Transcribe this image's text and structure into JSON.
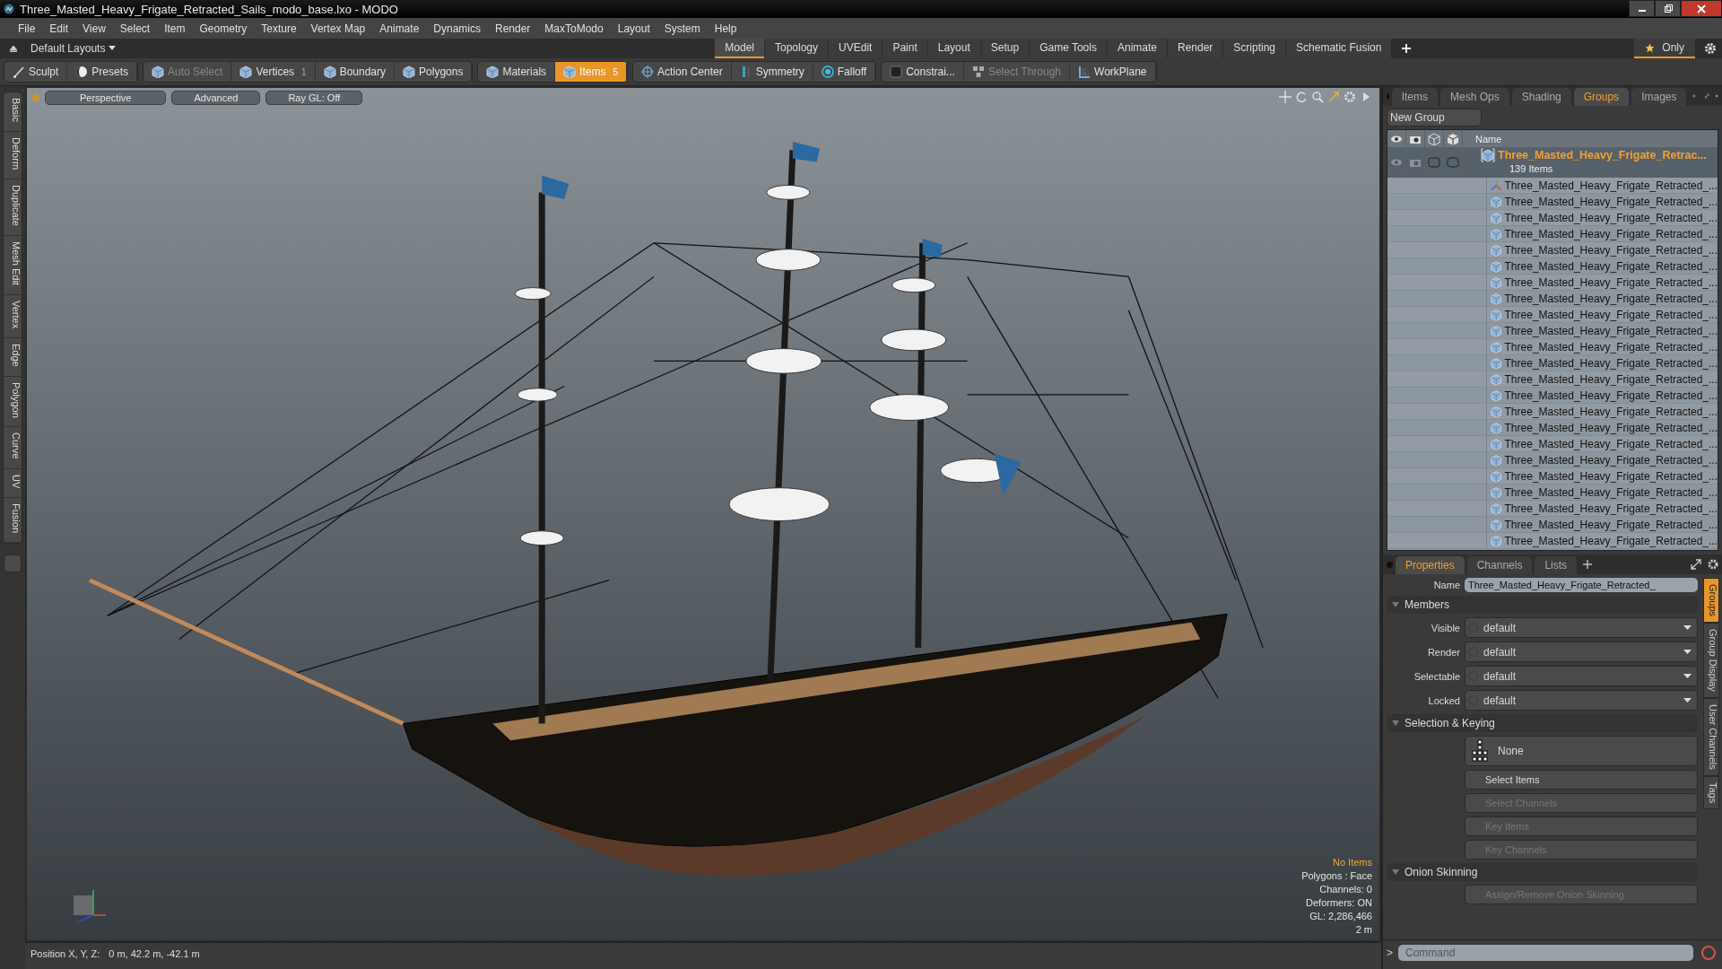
{
  "window": {
    "title": "Three_Masted_Heavy_Frigate_Retracted_Sails_modo_base.lxo - MODO"
  },
  "menu": [
    "File",
    "Edit",
    "View",
    "Select",
    "Item",
    "Geometry",
    "Texture",
    "Vertex Map",
    "Animate",
    "Dynamics",
    "Render",
    "MaxToModo",
    "Layout",
    "System",
    "Help"
  ],
  "layout_bar": {
    "layouts": "Default Layouts",
    "tabs": [
      {
        "label": "Model",
        "selected": true
      },
      {
        "label": "Topology",
        "selected": false
      },
      {
        "label": "UVEdit",
        "selected": false
      },
      {
        "label": "Paint",
        "selected": false
      },
      {
        "label": "Layout",
        "selected": false
      },
      {
        "label": "Setup",
        "selected": false
      },
      {
        "label": "Game Tools",
        "selected": false
      },
      {
        "label": "Animate",
        "selected": false
      },
      {
        "label": "Render",
        "selected": false
      },
      {
        "label": "Scripting",
        "selected": false
      },
      {
        "label": "Schematic Fusion",
        "selected": false
      }
    ],
    "only": "Only"
  },
  "toolbar": [
    [
      {
        "label": "Sculpt",
        "selected": false,
        "disabled": false
      },
      {
        "label": "Presets",
        "selected": false,
        "disabled": false
      }
    ],
    [
      {
        "label": "Auto Select",
        "selected": false,
        "disabled": true
      },
      {
        "label": "Vertices",
        "count": "1",
        "selected": false,
        "disabled": false
      },
      {
        "label": "Boundary",
        "selected": false,
        "disabled": false
      },
      {
        "label": "Polygons",
        "selected": false,
        "disabled": false
      }
    ],
    [
      {
        "label": "Materials",
        "selected": false,
        "disabled": false
      },
      {
        "label": "Items",
        "count": "5",
        "selected": true,
        "disabled": false
      }
    ],
    [
      {
        "label": "Action Center",
        "selected": false,
        "disabled": false
      },
      {
        "label": "Symmetry",
        "selected": false,
        "disabled": false
      },
      {
        "label": "Falloff",
        "selected": false,
        "disabled": false
      }
    ],
    [
      {
        "label": "Constrai...",
        "selected": false,
        "disabled": false
      },
      {
        "label": "Select Through",
        "selected": false,
        "disabled": true
      },
      {
        "label": "WorkPlane",
        "selected": false,
        "disabled": false
      }
    ]
  ],
  "left_tabs": [
    "Basic",
    "Deform",
    "Duplicate",
    "Mesh Edit",
    "Vertex",
    "Edge",
    "Polygon",
    "Curve",
    "UV",
    "Fusion"
  ],
  "viewport": {
    "buttons": [
      "Perspective",
      "Advanced",
      "Ray GL: Off"
    ],
    "info": [
      {
        "text": "No Items",
        "highlight": true
      },
      {
        "text": "Polygons : Face",
        "highlight": false
      },
      {
        "text": "Channels: 0",
        "highlight": false
      },
      {
        "text": "Deformers: ON",
        "highlight": false
      },
      {
        "text": "GL: 2,286,466",
        "highlight": false
      },
      {
        "text": "2 m",
        "highlight": false
      }
    ]
  },
  "status_bar": {
    "label": "Position X, Y, Z:",
    "value": "0 m, 42.2 m, -42.1 m"
  },
  "items_panel": {
    "tabs": [
      {
        "label": "Items",
        "selected": false
      },
      {
        "label": "Mesh Ops",
        "selected": false
      },
      {
        "label": "Shading",
        "selected": false
      },
      {
        "label": "Groups",
        "selected": true
      },
      {
        "label": "Images",
        "selected": false
      }
    ],
    "new_group": "New Group",
    "name_column": "Name",
    "group": {
      "name": "Three_Masted_Heavy_Frigate_Retrac...",
      "count": "139 Items",
      "children": [
        {
          "name": "Three_Masted_Heavy_Frigate_Retracted_...",
          "kind": "locator"
        },
        {
          "name": "Three_Masted_Heavy_Frigate_Retracted_...",
          "kind": "mesh"
        },
        {
          "name": "Three_Masted_Heavy_Frigate_Retracted_...",
          "kind": "mesh"
        },
        {
          "name": "Three_Masted_Heavy_Frigate_Retracted_...",
          "kind": "mesh"
        },
        {
          "name": "Three_Masted_Heavy_Frigate_Retracted_...",
          "kind": "mesh"
        },
        {
          "name": "Three_Masted_Heavy_Frigate_Retracted_...",
          "kind": "mesh"
        },
        {
          "name": "Three_Masted_Heavy_Frigate_Retracted_...",
          "kind": "mesh"
        },
        {
          "name": "Three_Masted_Heavy_Frigate_Retracted_...",
          "kind": "mesh"
        },
        {
          "name": "Three_Masted_Heavy_Frigate_Retracted_...",
          "kind": "mesh"
        },
        {
          "name": "Three_Masted_Heavy_Frigate_Retracted_...",
          "kind": "mesh"
        },
        {
          "name": "Three_Masted_Heavy_Frigate_Retracted_...",
          "kind": "mesh"
        },
        {
          "name": "Three_Masted_Heavy_Frigate_Retracted_...",
          "kind": "mesh"
        },
        {
          "name": "Three_Masted_Heavy_Frigate_Retracted_...",
          "kind": "mesh"
        },
        {
          "name": "Three_Masted_Heavy_Frigate_Retracted_...",
          "kind": "mesh"
        },
        {
          "name": "Three_Masted_Heavy_Frigate_Retracted_...",
          "kind": "mesh"
        },
        {
          "name": "Three_Masted_Heavy_Frigate_Retracted_...",
          "kind": "mesh"
        },
        {
          "name": "Three_Masted_Heavy_Frigate_Retracted_...",
          "kind": "mesh"
        },
        {
          "name": "Three_Masted_Heavy_Frigate_Retracted_...",
          "kind": "mesh"
        },
        {
          "name": "Three_Masted_Heavy_Frigate_Retracted_...",
          "kind": "mesh"
        },
        {
          "name": "Three_Masted_Heavy_Frigate_Retracted_...",
          "kind": "mesh"
        },
        {
          "name": "Three_Masted_Heavy_Frigate_Retracted_...",
          "kind": "mesh"
        },
        {
          "name": "Three_Masted_Heavy_Frigate_Retracted_...",
          "kind": "mesh"
        },
        {
          "name": "Three_Masted_Heavy_Frigate_Retracted_...",
          "kind": "mesh"
        }
      ]
    }
  },
  "properties_panel": {
    "tabs": [
      {
        "label": "Properties",
        "selected": true
      },
      {
        "label": "Channels",
        "selected": false
      },
      {
        "label": "Lists",
        "selected": false
      }
    ],
    "name_label": "Name",
    "name_value": "Three_Masted_Heavy_Frigate_Retracted_",
    "sections": [
      {
        "title": "Members",
        "kind": "fields",
        "fields": [
          {
            "label": "Visible",
            "value": "default"
          },
          {
            "label": "Render",
            "value": "default"
          },
          {
            "label": "Selectable",
            "value": "default"
          },
          {
            "label": "Locked",
            "value": "default"
          }
        ]
      },
      {
        "title": "Selection & Keying",
        "kind": "buttons",
        "preset": "None",
        "buttons": [
          {
            "label": "Select Items",
            "disabled": false
          },
          {
            "label": "Select Channels",
            "disabled": true
          },
          {
            "label": "Key Items",
            "disabled": true
          },
          {
            "label": "Key Channels",
            "disabled": true
          }
        ]
      },
      {
        "title": "Onion Skinning",
        "kind": "buttons",
        "buttons": [
          {
            "label": "Assign/Remove Onion Skinning",
            "disabled": true
          }
        ]
      }
    ],
    "side_tabs": [
      {
        "label": "Groups",
        "selected": true
      },
      {
        "label": "Group Display",
        "selected": false
      },
      {
        "label": "User Channels",
        "selected": false
      },
      {
        "label": "Tags",
        "selected": false
      }
    ]
  },
  "command": {
    "prompt": ">",
    "placeholder": "Command"
  }
}
